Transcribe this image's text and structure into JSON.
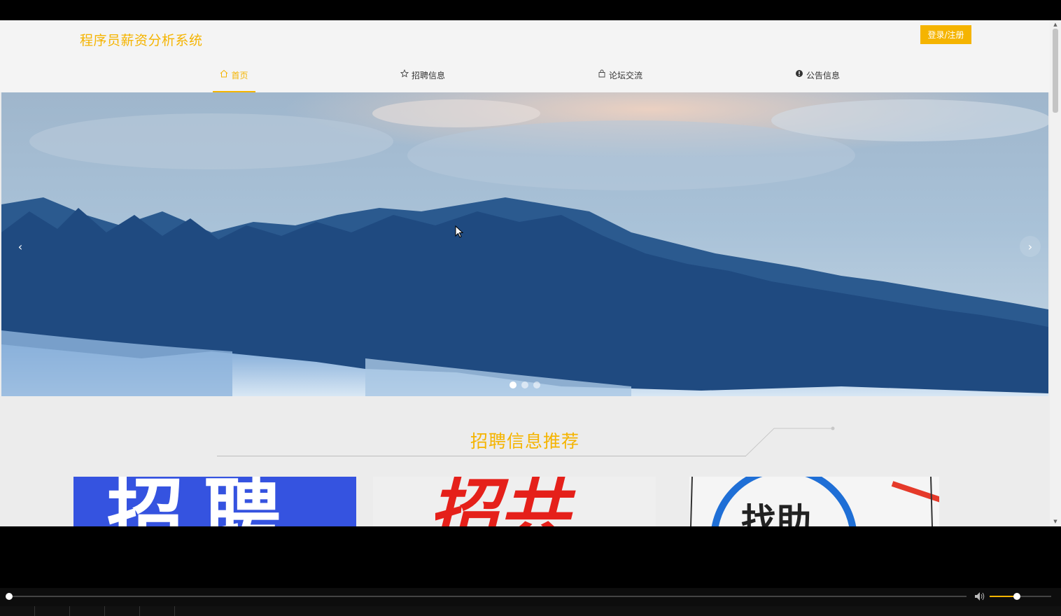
{
  "header": {
    "site_title": "程序员薪资分析系统",
    "login_label": "登录/注册"
  },
  "nav": {
    "items": [
      {
        "label": "首页",
        "icon": "home-icon",
        "active": true
      },
      {
        "label": "招聘信息",
        "icon": "star-icon",
        "active": false
      },
      {
        "label": "论坛交流",
        "icon": "bag-icon",
        "active": false
      },
      {
        "label": "公告信息",
        "icon": "info-icon",
        "active": false
      }
    ]
  },
  "banner": {
    "prev": "‹",
    "next": "›",
    "slide_count": 3,
    "active_slide": 1
  },
  "section": {
    "title": "招聘信息推荐"
  },
  "cards": [
    {
      "text": "招聘"
    },
    {
      "text": "招共"
    },
    {
      "text": "找助"
    }
  ],
  "colors": {
    "accent": "#f5b400",
    "page_bg": "#ececec",
    "header_bg": "#f4f4f4"
  },
  "player": {
    "progress": 0.0,
    "volume": 0.45
  }
}
